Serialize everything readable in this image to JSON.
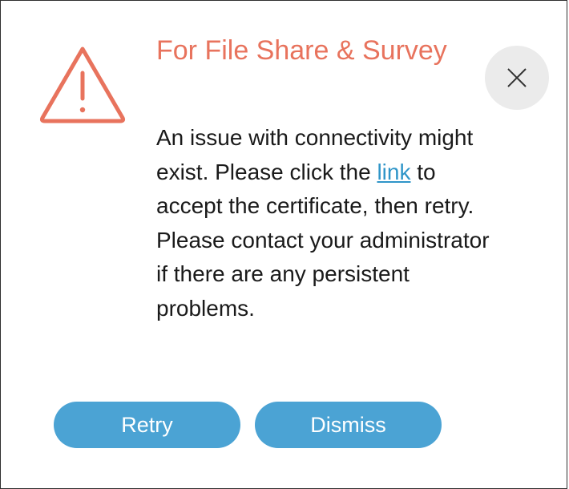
{
  "dialog": {
    "title": "For File Share & Survey",
    "message": {
      "before_link": "An issue with connectivity might exist. Please click the ",
      "link_text": "link",
      "after_link": " to accept the certificate, then retry. Please contact your administrator if there are any persistent problems."
    },
    "buttons": {
      "retry_label": "Retry",
      "dismiss_label": "Dismiss"
    },
    "icons": {
      "warning": "warning-triangle-icon",
      "close": "close-icon"
    },
    "colors": {
      "title": "#e8735d",
      "warning_icon": "#e8735d",
      "link": "#2f95c8",
      "button_bg": "#4ba3d4",
      "close_bg": "#ebebeb"
    }
  }
}
